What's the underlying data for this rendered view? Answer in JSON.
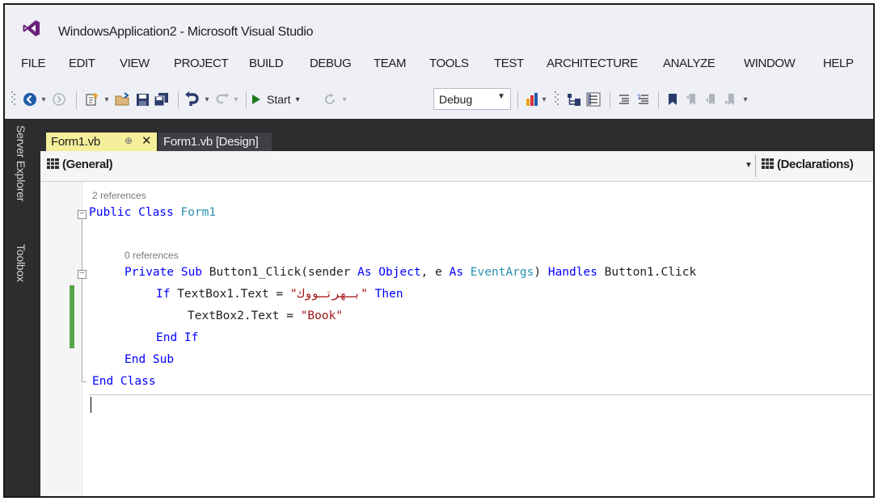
{
  "window": {
    "title": "WindowsApplication2 - Microsoft Visual Studio"
  },
  "menu": [
    "FILE",
    "EDIT",
    "VIEW",
    "PROJECT",
    "BUILD",
    "DEBUG",
    "TEAM",
    "TOOLS",
    "TEST",
    "ARCHITECTURE",
    "ANALYZE",
    "WINDOW",
    "HELP"
  ],
  "toolbar": {
    "start_label": "Start",
    "configuration": "Debug",
    "icons": [
      "back-icon",
      "forward-icon",
      "new-project-icon",
      "open-file-icon",
      "save-icon",
      "save-all-icon",
      "undo-icon",
      "redo-icon",
      "start-icon",
      "refresh-icon",
      "find-icon",
      "solution-explorer-icon",
      "properties-icon",
      "comment-icon",
      "uncomment-icon",
      "bookmark-icon"
    ]
  },
  "side_tabs": {
    "server_explorer": "Server Explorer",
    "toolbox": "Toolbox"
  },
  "tabs": {
    "active": "Form1.vb",
    "active_pin": "⊕",
    "active_close": "✕",
    "design": "Form1.vb [Design]"
  },
  "navigation": {
    "left": "(General)",
    "right": "(Declarations)"
  },
  "code": {
    "hint_class": "2 references",
    "hint_sub": "0 references",
    "line1_kw1": "Public Class",
    "line1_name": " Form1",
    "line2_kw": "Private Sub",
    "line2_text1": " Button1_Click(sender ",
    "line2_as1": "As",
    "line2_object": " Object",
    "line2_text2": ", e ",
    "line2_as2": "As",
    "line2_type": " EventArgs",
    "line2_text3": ") ",
    "line2_handles": "Handles",
    "line2_text4": " Button1.Click",
    "line3_if": "If",
    "line3_text": " TextBox1.Text = ",
    "line3_str": "\"بـهرتـووك\"",
    "line3_then": " Then",
    "line4_text": "TextBox2.Text = ",
    "line4_str": "\"Book\"",
    "line5": "End If",
    "line6": "End Sub",
    "line7": "End Class"
  },
  "colors": {
    "keyword": "#0000ff",
    "type": "#2b91af",
    "string": "#a31515",
    "change_bar": "#57a64a",
    "active_tab": "#f5ee9a",
    "chrome_dark": "#2d2d30"
  }
}
